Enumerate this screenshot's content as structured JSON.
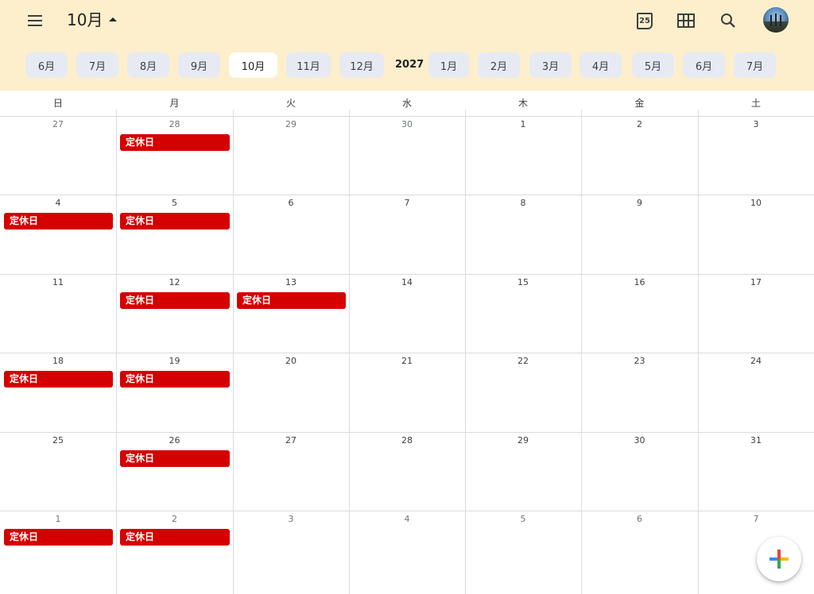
{
  "header": {
    "month_title": "10月",
    "today_icon_label": "25"
  },
  "icons": {
    "menu": "menu-icon",
    "dropdown": "caret-up-icon",
    "today": "calendar-today-icon",
    "grid": "grid-view-icon",
    "search": "search-icon",
    "add": "add-icon"
  },
  "month_chips": [
    {
      "label": "6月",
      "active": false
    },
    {
      "label": "7月",
      "active": false
    },
    {
      "label": "8月",
      "active": false
    },
    {
      "label": "9月",
      "active": false
    },
    {
      "label": "10月",
      "active": true
    },
    {
      "label": "11月",
      "active": false
    },
    {
      "label": "12月",
      "active": false
    },
    {
      "label": "1月",
      "active": false
    },
    {
      "label": "2月",
      "active": false
    },
    {
      "label": "3月",
      "active": false
    },
    {
      "label": "4月",
      "active": false
    },
    {
      "label": "5月",
      "active": false
    },
    {
      "label": "6月",
      "active": false
    },
    {
      "label": "7月",
      "active": false
    }
  ],
  "year_label": "2027",
  "weekdays": [
    "日",
    "月",
    "火",
    "水",
    "木",
    "金",
    "土"
  ],
  "weeks": [
    [
      {
        "day": "27",
        "muted": true,
        "event": ""
      },
      {
        "day": "28",
        "muted": true,
        "event": "定休日"
      },
      {
        "day": "29",
        "muted": true,
        "event": ""
      },
      {
        "day": "30",
        "muted": true,
        "event": ""
      },
      {
        "day": "1",
        "muted": false,
        "event": ""
      },
      {
        "day": "2",
        "muted": false,
        "event": ""
      },
      {
        "day": "3",
        "muted": false,
        "event": ""
      }
    ],
    [
      {
        "day": "4",
        "muted": false,
        "event": "定休日"
      },
      {
        "day": "5",
        "muted": false,
        "event": "定休日"
      },
      {
        "day": "6",
        "muted": false,
        "event": ""
      },
      {
        "day": "7",
        "muted": false,
        "event": ""
      },
      {
        "day": "8",
        "muted": false,
        "event": ""
      },
      {
        "day": "9",
        "muted": false,
        "event": ""
      },
      {
        "day": "10",
        "muted": false,
        "event": ""
      }
    ],
    [
      {
        "day": "11",
        "muted": false,
        "event": ""
      },
      {
        "day": "12",
        "muted": false,
        "event": "定休日"
      },
      {
        "day": "13",
        "muted": false,
        "event": "定休日"
      },
      {
        "day": "14",
        "muted": false,
        "event": ""
      },
      {
        "day": "15",
        "muted": false,
        "event": ""
      },
      {
        "day": "16",
        "muted": false,
        "event": ""
      },
      {
        "day": "17",
        "muted": false,
        "event": ""
      }
    ],
    [
      {
        "day": "18",
        "muted": false,
        "event": "定休日"
      },
      {
        "day": "19",
        "muted": false,
        "event": "定休日"
      },
      {
        "day": "20",
        "muted": false,
        "event": ""
      },
      {
        "day": "21",
        "muted": false,
        "event": ""
      },
      {
        "day": "22",
        "muted": false,
        "event": ""
      },
      {
        "day": "23",
        "muted": false,
        "event": ""
      },
      {
        "day": "24",
        "muted": false,
        "event": ""
      }
    ],
    [
      {
        "day": "25",
        "muted": false,
        "event": ""
      },
      {
        "day": "26",
        "muted": false,
        "event": "定休日"
      },
      {
        "day": "27",
        "muted": false,
        "event": ""
      },
      {
        "day": "28",
        "muted": false,
        "event": ""
      },
      {
        "day": "29",
        "muted": false,
        "event": ""
      },
      {
        "day": "30",
        "muted": false,
        "event": ""
      },
      {
        "day": "31",
        "muted": false,
        "event": ""
      }
    ],
    [
      {
        "day": "1",
        "muted": true,
        "event": "定休日"
      },
      {
        "day": "2",
        "muted": true,
        "event": "定休日"
      },
      {
        "day": "3",
        "muted": true,
        "event": ""
      },
      {
        "day": "4",
        "muted": true,
        "event": ""
      },
      {
        "day": "5",
        "muted": true,
        "event": ""
      },
      {
        "day": "6",
        "muted": true,
        "event": ""
      },
      {
        "day": "7",
        "muted": true,
        "event": ""
      }
    ]
  ],
  "colors": {
    "header_bg": "#fdefcb",
    "chip_bg": "#e8eaf3",
    "event_bg": "#d50000",
    "grid_line": "#dadce0"
  }
}
